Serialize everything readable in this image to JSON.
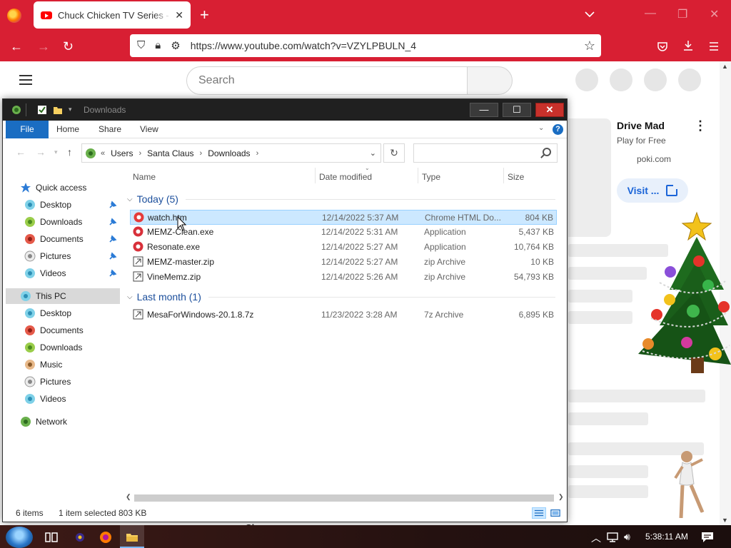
{
  "browser": {
    "tab_title": "Chuck Chicken TV Series - The Official...",
    "tab_close": "✕",
    "new_tab": "+",
    "url": "https://www.youtube.com/watch?v=VZYLPBULN_4"
  },
  "youtube": {
    "search_placeholder": "Search",
    "ad": {
      "title": "Drive Mad",
      "subtitle": "Play for Free",
      "domain": "poki.com",
      "visit_label": "Visit ..."
    },
    "show_more": "Show more"
  },
  "explorer": {
    "window_title": "Downloads",
    "ribbon": {
      "file": "File",
      "home": "Home",
      "share": "Share",
      "view": "View",
      "help": "?"
    },
    "address": {
      "chevrons": "«",
      "crumbs": [
        "Users",
        "Santa Claus",
        "Downloads"
      ]
    },
    "nav": {
      "quick_access": "Quick access",
      "quick_items": [
        "Desktop",
        "Downloads",
        "Documents",
        "Pictures",
        "Videos"
      ],
      "this_pc": "This PC",
      "pc_items": [
        "Desktop",
        "Documents",
        "Downloads",
        "Music",
        "Pictures",
        "Videos"
      ],
      "network": "Network"
    },
    "columns": {
      "name": "Name",
      "date": "Date modified",
      "type": "Type",
      "size": "Size"
    },
    "groups": [
      {
        "label": "Today (5)",
        "files": [
          {
            "name": "watch.htm",
            "date": "12/14/2022 5:37 AM",
            "type": "Chrome HTML Do...",
            "size": "804 KB",
            "icon": "chrome-html-icon",
            "selected": true
          },
          {
            "name": "MEMZ-Clean.exe",
            "date": "12/14/2022 5:31 AM",
            "type": "Application",
            "size": "5,437 KB",
            "icon": "application-icon",
            "selected": false
          },
          {
            "name": "Resonate.exe",
            "date": "12/14/2022 5:27 AM",
            "type": "Application",
            "size": "10,764 KB",
            "icon": "application-icon",
            "selected": false
          },
          {
            "name": "MEMZ-master.zip",
            "date": "12/14/2022 5:27 AM",
            "type": "zip Archive",
            "size": "10 KB",
            "icon": "zip-icon",
            "selected": false
          },
          {
            "name": "VineMemz.zip",
            "date": "12/14/2022 5:26 AM",
            "type": "zip Archive",
            "size": "54,793 KB",
            "icon": "zip-icon",
            "selected": false
          }
        ]
      },
      {
        "label": "Last month (1)",
        "files": [
          {
            "name": "MesaForWindows-20.1.8.7z",
            "date": "11/23/2022 3:28 AM",
            "type": "7z Archive",
            "size": "6,895 KB",
            "icon": "archive-icon",
            "selected": false
          }
        ]
      }
    ],
    "status": {
      "items": "6 items",
      "selected": "1 item selected",
      "size": "803 KB"
    }
  },
  "taskbar": {
    "clock": "5:38:11 AM"
  },
  "colors": {
    "browser_accent": "#d81f33",
    "explorer_file_tab": "#1a6dc2",
    "selection": "#cce8ff",
    "group_heading": "#1c4f9c"
  }
}
